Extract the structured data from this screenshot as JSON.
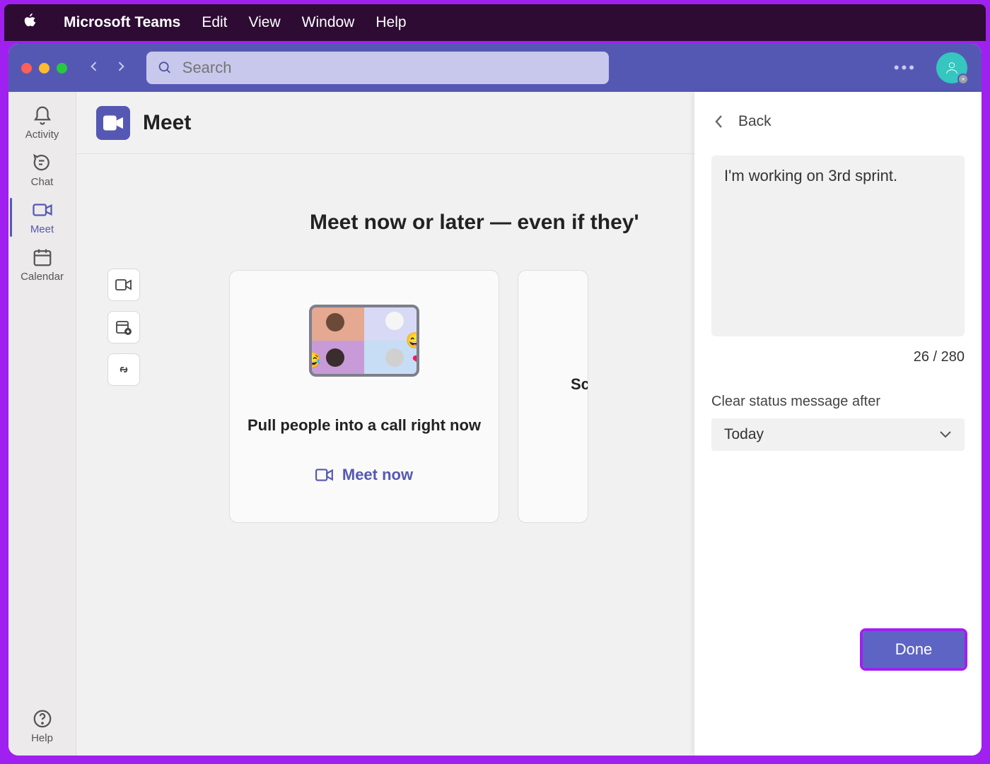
{
  "menubar": {
    "app_name": "Microsoft Teams",
    "items": [
      "Edit",
      "View",
      "Window",
      "Help"
    ]
  },
  "titlebar": {
    "search_placeholder": "Search"
  },
  "rail": {
    "items": [
      {
        "id": "activity",
        "label": "Activity"
      },
      {
        "id": "chat",
        "label": "Chat"
      },
      {
        "id": "meet",
        "label": "Meet"
      },
      {
        "id": "calendar",
        "label": "Calendar"
      }
    ],
    "help_label": "Help",
    "active": "meet"
  },
  "page": {
    "title": "Meet",
    "headline": "Meet now or later — even if they'",
    "card1_title": "Pull people into a call right now",
    "card1_action": "Meet now",
    "card2_title_partial": "Sc"
  },
  "status_panel": {
    "back_label": "Back",
    "message": "I'm working on 3rd sprint.",
    "char_count": "26 / 280",
    "clear_label": "Clear status message after",
    "clear_value": "Today",
    "done_label": "Done"
  }
}
